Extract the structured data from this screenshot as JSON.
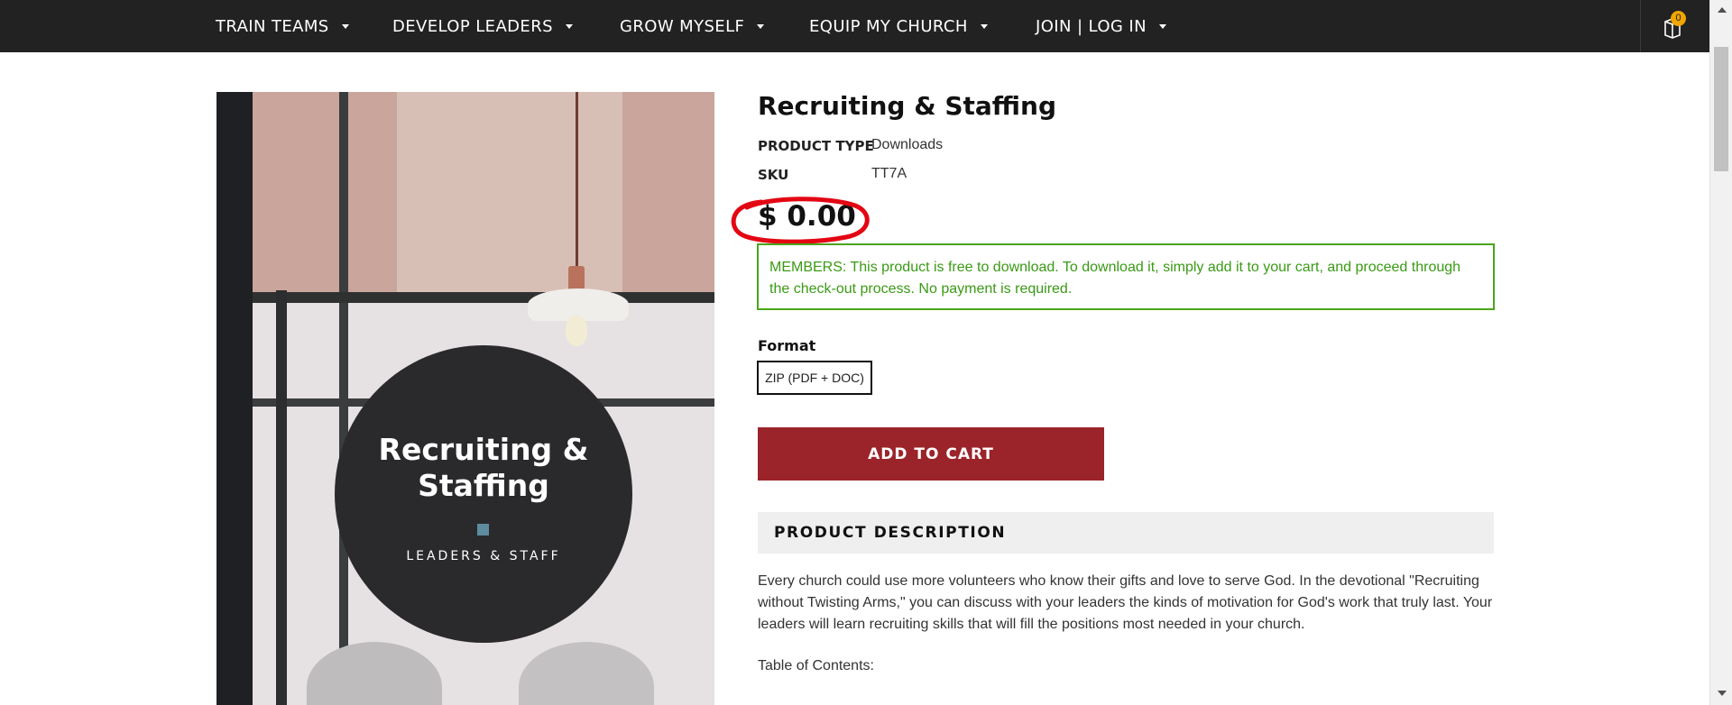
{
  "nav": {
    "items": [
      {
        "label": "TRAIN TEAMS"
      },
      {
        "label": "DEVELOP LEADERS"
      },
      {
        "label": "GROW MYSELF"
      },
      {
        "label": "EQUIP MY CHURCH"
      },
      {
        "label": "JOIN | LOG IN"
      }
    ],
    "cart_count": "0",
    "cart_icon": "cart-icon"
  },
  "product": {
    "image": {
      "title": "Recruiting & Staffing",
      "subtitle": "LEADERS & STAFF"
    },
    "title": "Recruiting & Staffing",
    "meta": [
      {
        "label": "PRODUCT TYPE",
        "value": "Downloads"
      },
      {
        "label": "SKU",
        "value": "TT7A"
      }
    ],
    "price": "$ 0.00",
    "members_note": "MEMBERS: This product is free to download. To download it, simply add it to your cart, and proceed through the check-out process. No payment is required.",
    "format_label": "Format",
    "format_option": "ZIP (PDF + DOC)",
    "add_to_cart": "ADD TO CART",
    "description_header": "PRODUCT DESCRIPTION",
    "description": "Every church could use more volunteers who know their gifts and love to serve God. In the devotional \"Recruiting without Twisting Arms,\" you can discuss with your leaders the kinds of motivation for God's work that truly last. Your leaders will learn recruiting skills that will fill the positions most needed in your church.",
    "toc_label": "Table of Contents:"
  },
  "colors": {
    "nav_bg": "#222222",
    "button_bg": "#9b242a",
    "members_green": "#3a9a15",
    "highlight_red": "#e30613",
    "badge": "#f0a500"
  }
}
